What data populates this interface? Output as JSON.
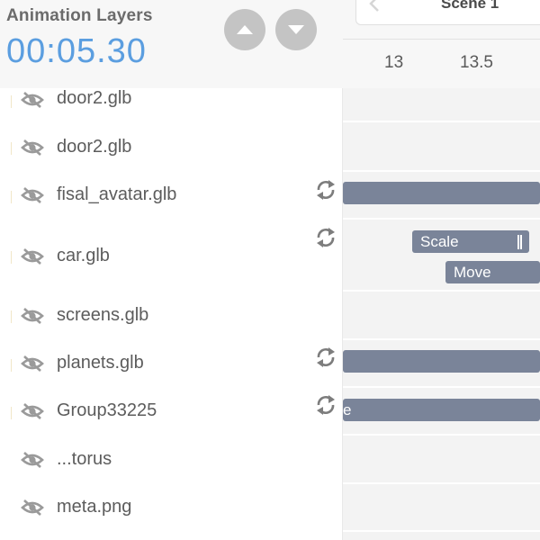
{
  "header": {
    "title": "Animation Layers",
    "timecode": "00:05.30",
    "up_button": "chevron-up-icon",
    "down_button": "chevron-down-icon"
  },
  "layers": [
    {
      "name": "door2.glb",
      "icon": "eye-slash-icon",
      "loop": false
    },
    {
      "name": "door2.glb",
      "icon": "eye-slash-icon",
      "loop": false
    },
    {
      "name": "fisal_avatar.glb",
      "icon": "eye-slash-icon",
      "loop": true
    },
    {
      "name": "car.glb",
      "icon": "eye-slash-icon",
      "loop": true
    },
    {
      "name": "screens.glb",
      "icon": "eye-slash-icon",
      "loop": false
    },
    {
      "name": "planets.glb",
      "icon": "eye-slash-icon",
      "loop": true
    },
    {
      "name": "Group33225",
      "icon": "eye-slash-icon",
      "loop": true
    },
    {
      "name": "...torus",
      "icon": "eye-slash-icon",
      "loop": false
    },
    {
      "name": "meta.png",
      "icon": "eye-slash-icon",
      "loop": false
    }
  ],
  "timeline": {
    "scene_label": "Scene 1",
    "ticks": [
      "13",
      "13.5"
    ],
    "clips": {
      "scale_label": "Scale",
      "move_label": "Move",
      "group_clip_label": "e"
    }
  },
  "colors": {
    "accent_blue": "#5b9ee0",
    "clip_fill": "#7a8499",
    "button_gray": "#c4c4c4"
  }
}
